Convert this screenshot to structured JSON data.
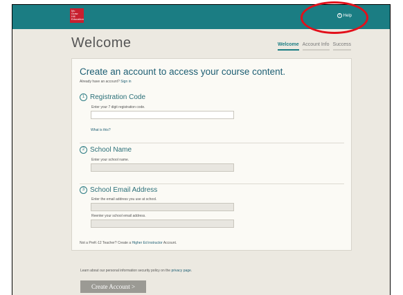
{
  "header": {
    "logo_lines": [
      "Mc",
      "Graw",
      "Hill",
      "Education"
    ],
    "help_label": "Help",
    "help_icon": "question-circle-icon"
  },
  "page": {
    "title": "Welcome",
    "tabs": [
      {
        "label": "Welcome",
        "active": true
      },
      {
        "label": "Account Info",
        "active": false
      },
      {
        "label": "Success",
        "active": false
      }
    ]
  },
  "form": {
    "heading": "Create an account to access your course content.",
    "signin_prefix": "Already have an account? ",
    "signin_link": "Sign in",
    "steps": [
      {
        "number": "1",
        "title": "Registration Code",
        "label": "Enter your 7 digit registration code.",
        "value": "",
        "link": "What is this?"
      },
      {
        "number": "2",
        "title": "School Name",
        "label": "Enter your school name.",
        "value": ""
      },
      {
        "number": "3",
        "title": "School Email Address",
        "label": "Enter the email address you use at school.",
        "label2": "Reenter your school email address.",
        "value": "",
        "value2": ""
      }
    ],
    "notprek_prefix": "Not a PreK-12 Teacher? Create a ",
    "notprek_link": "Higher Ed instructor",
    "notprek_suffix": " Account."
  },
  "footer": {
    "policy_prefix": "Learn about our personal information security policy on the ",
    "policy_link": "privacy page",
    "policy_suffix": ".",
    "create_button": "Create Account >"
  },
  "annotation": {
    "color": "#e2101b",
    "shape": "ellipse-around-help"
  }
}
